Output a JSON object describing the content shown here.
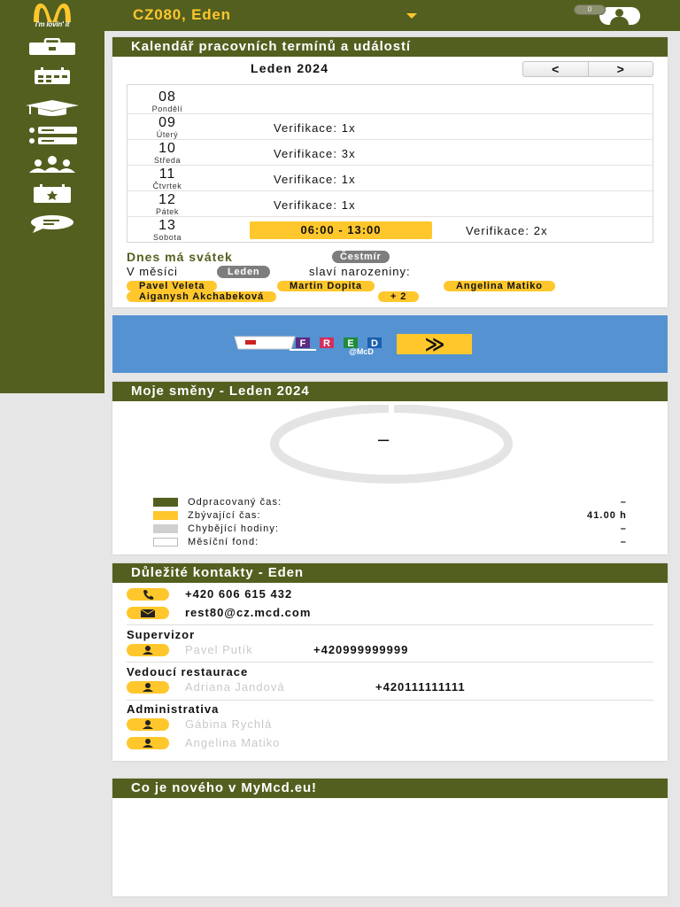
{
  "header": {
    "logo_slogan": "i'm lovin' it",
    "store_name": "CZ080, Eden",
    "notification_label": "0",
    "colors": {
      "olive": "#535f1f",
      "yellow": "#ffc72c",
      "blue": "#5592d1"
    }
  },
  "sidebar": {
    "items": [
      {
        "icon": "briefcase-icon"
      },
      {
        "icon": "calendar-icon"
      },
      {
        "icon": "graduation-cap-icon"
      },
      {
        "icon": "list-icon"
      },
      {
        "icon": "team-icon"
      },
      {
        "icon": "calendar-star-icon"
      },
      {
        "icon": "chat-bubble-icon"
      }
    ]
  },
  "calendar": {
    "title": "Kalendář pracovních termínů a událostí",
    "month": "Leden 2024",
    "prev_label": "<",
    "next_label": ">",
    "days": [
      {
        "num": "08",
        "name": "Pondělí",
        "event": "",
        "shift": "",
        "event_right": ""
      },
      {
        "num": "09",
        "name": "Úterý",
        "event": "Verifikace: 1x",
        "shift": "",
        "event_right": ""
      },
      {
        "num": "10",
        "name": "Středa",
        "event": "Verifikace: 3x",
        "shift": "",
        "event_right": ""
      },
      {
        "num": "11",
        "name": "Čtvrtek",
        "event": "Verifikace: 1x",
        "shift": "",
        "event_right": ""
      },
      {
        "num": "12",
        "name": "Pátek",
        "event": "Verifikace: 1x",
        "shift": "",
        "event_right": ""
      },
      {
        "num": "13",
        "name": "Sobota",
        "event": "",
        "shift": "06:00 - 13:00",
        "event_right": "Verifikace: 2x"
      }
    ],
    "nameday_label": "Dnes má svátek",
    "nameday_name": "Čestmír",
    "birthday_prefix": "V měsíci",
    "birthday_month": "Leden",
    "birthday_suffix": "slaví narozeniny:",
    "birthdays": [
      "Pavel Veleta",
      "Martin Dopita",
      "Angelina Matiko",
      "Aiganysh Akchabeková",
      "+ 2"
    ]
  },
  "fred_banner": {
    "letters": [
      "F",
      "R",
      "E",
      "D"
    ],
    "subtitle": "@McD",
    "arrow": "≫"
  },
  "shifts": {
    "title": "Moje směny - Leden 2024",
    "center_value": "–",
    "legend": [
      {
        "label": "Odpracovaný čas:",
        "value": "–",
        "color": "#535f1f"
      },
      {
        "label": "Zbývající čas:",
        "value": "41.00 h",
        "color": "#ffc72c"
      },
      {
        "label": "Chybějící hodiny:",
        "value": "–",
        "color": "#cfcfcf"
      },
      {
        "label": "Měsíční fond:",
        "value": "–",
        "color": "#ffffff"
      }
    ]
  },
  "contacts": {
    "title": "Důležité kontakty - Eden",
    "phone": "+420 606 615 432",
    "email": "rest80@cz.mcd.com",
    "supervisor_label": "Supervizor",
    "supervisor": {
      "name": "Pavel Putík",
      "phone": "+420999999999"
    },
    "manager_label": "Vedoucí restaurace",
    "manager": {
      "name": "Adriana Jandová",
      "phone": "+420111111111"
    },
    "admin_label": "Administrativa",
    "admins": [
      "Gábina Rychlá",
      "Angelina Matiko"
    ]
  },
  "news": {
    "title": "Co je nového v MyMcd.eu!"
  }
}
